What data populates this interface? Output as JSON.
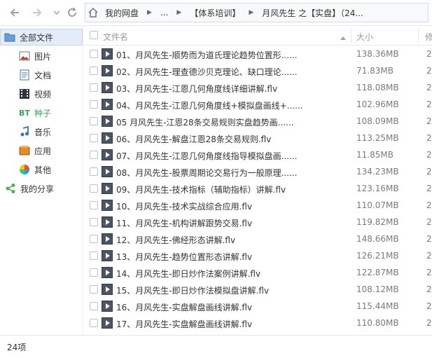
{
  "toolbar": {
    "breadcrumb": [
      "我的网盘",
      "...",
      "【体系培训】",
      "月风先生 之【实盘】（24..."
    ]
  },
  "sidebar": {
    "items": [
      {
        "label": "全部文件",
        "icon": "folder-icon",
        "active": true
      },
      {
        "label": "图片",
        "icon": "image-icon"
      },
      {
        "label": "文档",
        "icon": "document-icon"
      },
      {
        "label": "视频",
        "icon": "video-icon"
      },
      {
        "label": "种子",
        "icon": "bt-icon"
      },
      {
        "label": "音乐",
        "icon": "music-icon"
      },
      {
        "label": "应用",
        "icon": "app-icon"
      },
      {
        "label": "其他",
        "icon": "other-icon"
      },
      {
        "label": "我的分享",
        "icon": "share-icon"
      }
    ]
  },
  "list": {
    "columns": {
      "name": "文件名",
      "size": "大小",
      "modified": "修"
    },
    "rows": [
      {
        "name": "01、月风先生-顺势而为道氏理论趋势位置形......",
        "size": "138.36MB",
        "mod": "2"
      },
      {
        "name": "02、月风先生-理查德沙贝克理论、缺口理论......",
        "size": "71.83MB",
        "mod": "2"
      },
      {
        "name": "03、月风先生-江恩几何角度线详细讲解.flv",
        "size": "118.08MB",
        "mod": "2"
      },
      {
        "name": "04、月风先生-江恩几何角度线+模拟盘画线+......",
        "size": "102.96MB",
        "mod": "2"
      },
      {
        "name": "05  月风先生-江恩28条交易规则实盘趋势画......",
        "size": "108.09MB",
        "mod": "2"
      },
      {
        "name": "06、月风先生-解盘江恩28条交易规则.flv",
        "size": "113.25MB",
        "mod": "2"
      },
      {
        "name": "07、月风先生-江恩几何角度线指导模拟盘画......",
        "size": "11.85MB",
        "mod": "2"
      },
      {
        "name": "08、月风先生-股票周期论交易行为一般原理......",
        "size": "134.23MB",
        "mod": "2"
      },
      {
        "name": "09、月风先生-技术指标（辅助指标）讲解.flv",
        "size": "123.16MB",
        "mod": "2"
      },
      {
        "name": "10、月风先生-技术实战综合应用.flv",
        "size": "110.07MB",
        "mod": "2"
      },
      {
        "name": "11、月风先生-机构讲解跟势交易.flv",
        "size": "119.82MB",
        "mod": "2"
      },
      {
        "name": "12、月风先生-佛经形态讲解.flv",
        "size": "148.66MB",
        "mod": "2"
      },
      {
        "name": "13、月风先生-趋势位置形态讲解.flv",
        "size": "126.21MB",
        "mod": "2"
      },
      {
        "name": "14、月风先生-即日炒作法案例讲解.flv",
        "size": "122.87MB",
        "mod": "2"
      },
      {
        "name": "15、月风先生-即日炒作法模拟盘讲解.flv",
        "size": "108.12MB",
        "mod": "2"
      },
      {
        "name": "16、月风先生-实盘解盘画线讲解.flv",
        "size": "115.44MB",
        "mod": "2"
      },
      {
        "name": "17、月风先生-实盘解盘画线讲解.flv",
        "size": "110.80MB",
        "mod": "2"
      }
    ]
  },
  "status": {
    "count": "24项"
  }
}
